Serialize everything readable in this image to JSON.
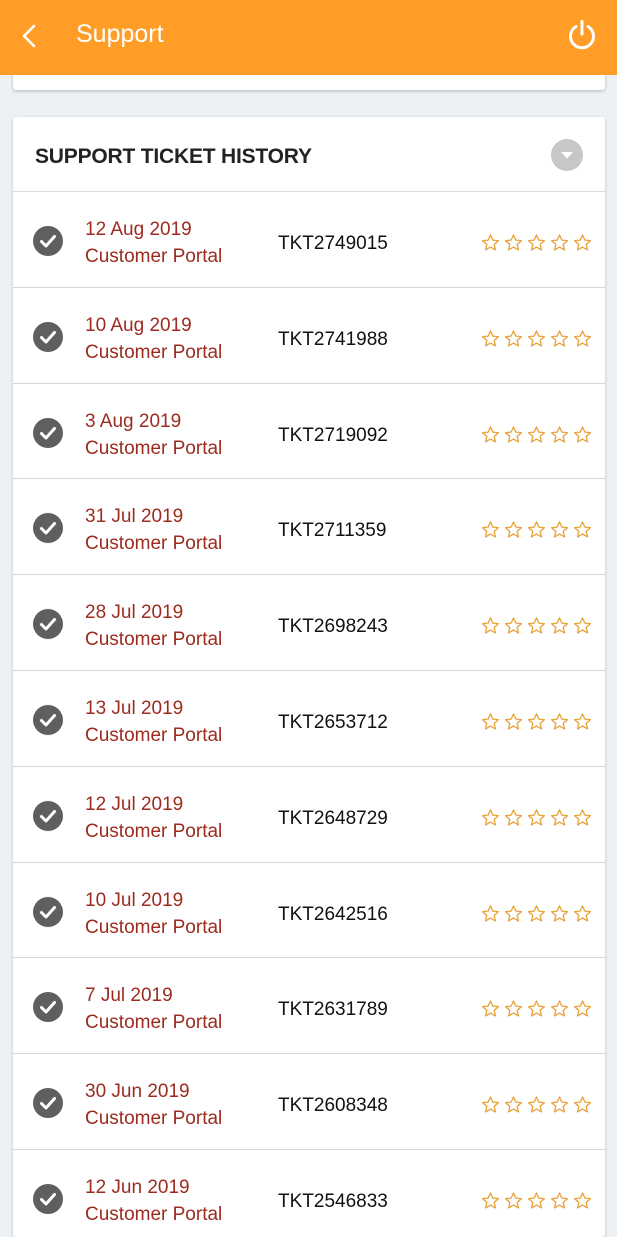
{
  "app_bar": {
    "title": "Support",
    "back_icon": "chevron-left-icon",
    "power_icon": "power-icon",
    "background": "#ff9d26"
  },
  "ticket_history": {
    "title": "SUPPORT TICKET HISTORY",
    "collapse_icon": "caret-down-icon",
    "status_icon": "check-circle-icon",
    "rating_max": 5,
    "rating_icon": "star-outline-icon",
    "accent_color": "#9c2b20",
    "star_color": "#e8a33a",
    "tickets": [
      {
        "date": "12 Aug 2019",
        "source": "Customer Portal",
        "ticket_id": "TKT2749015",
        "rating": 0
      },
      {
        "date": "10 Aug 2019",
        "source": "Customer Portal",
        "ticket_id": "TKT2741988",
        "rating": 0
      },
      {
        "date": "3 Aug 2019",
        "source": "Customer Portal",
        "ticket_id": "TKT2719092",
        "rating": 0
      },
      {
        "date": "31 Jul 2019",
        "source": "Customer Portal",
        "ticket_id": "TKT2711359",
        "rating": 0
      },
      {
        "date": "28 Jul 2019",
        "source": "Customer Portal",
        "ticket_id": "TKT2698243",
        "rating": 0
      },
      {
        "date": "13 Jul 2019",
        "source": "Customer Portal",
        "ticket_id": "TKT2653712",
        "rating": 0
      },
      {
        "date": "12 Jul 2019",
        "source": "Customer Portal",
        "ticket_id": "TKT2648729",
        "rating": 0
      },
      {
        "date": "10 Jul 2019",
        "source": "Customer Portal",
        "ticket_id": "TKT2642516",
        "rating": 0
      },
      {
        "date": "7 Jul 2019",
        "source": "Customer Portal",
        "ticket_id": "TKT2631789",
        "rating": 0
      },
      {
        "date": "30 Jun 2019",
        "source": "Customer Portal",
        "ticket_id": "TKT2608348",
        "rating": 0
      },
      {
        "date": "12 Jun 2019",
        "source": "Customer Portal",
        "ticket_id": "TKT2546833",
        "rating": 0
      }
    ]
  }
}
